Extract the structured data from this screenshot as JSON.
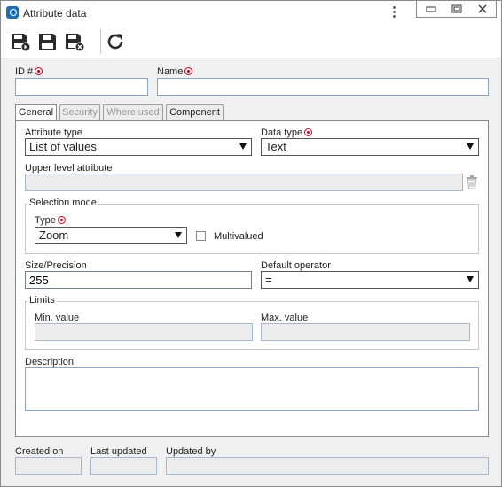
{
  "window": {
    "title": "Attribute data"
  },
  "fields": {
    "id_label": "ID #",
    "id_value": "",
    "name_label": "Name",
    "name_value": ""
  },
  "tabs": [
    {
      "label": "General",
      "active": true
    },
    {
      "label": "Security",
      "active": false
    },
    {
      "label": "Where used",
      "active": false
    },
    {
      "label": "Component",
      "active": false
    }
  ],
  "general": {
    "attribute_type_label": "Attribute type",
    "attribute_type_value": "List of values",
    "data_type_label": "Data type",
    "data_type_value": "Text",
    "upper_level_label": "Upper level attribute",
    "upper_level_value": "",
    "selection_mode": {
      "title": "Selection mode",
      "type_label": "Type",
      "type_value": "Zoom",
      "multivalued_label": "Multivalued",
      "multivalued_checked": false
    },
    "size_label": "Size/Precision",
    "size_value": "255",
    "default_operator_label": "Default operator",
    "default_operator_value": "=",
    "limits": {
      "title": "Limits",
      "min_label": "Min. value",
      "min_value": "",
      "max_label": "Max. value",
      "max_value": ""
    },
    "description_label": "Description",
    "description_value": ""
  },
  "footer": {
    "created_on_label": "Created on",
    "created_on_value": "",
    "last_updated_label": "Last updated",
    "last_updated_value": "",
    "updated_by_label": "Updated by",
    "updated_by_value": ""
  },
  "colors": {
    "required": "#d0021b",
    "toolbar_icon": "#2b2b2b",
    "app_icon": "#1e6fb5"
  },
  "icons": [
    "app-icon",
    "kebab-menu-icon",
    "minimize-icon",
    "restore-icon",
    "close-icon",
    "save-and-new-icon",
    "save-icon",
    "save-and-close-icon",
    "refresh-icon",
    "trash-icon",
    "required-icon"
  ]
}
